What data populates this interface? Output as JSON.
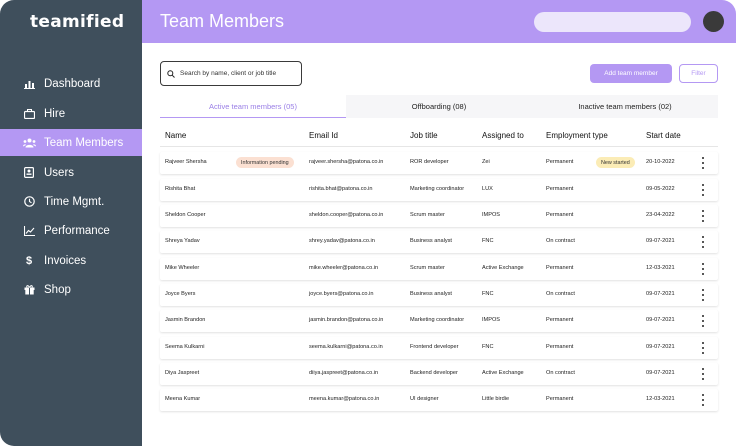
{
  "brand": {
    "logo": "teamified"
  },
  "nav": {
    "items": [
      {
        "label": "Dashboard",
        "icon": "bar-chart-icon",
        "active": false
      },
      {
        "label": "Hire",
        "icon": "briefcase-icon",
        "active": false
      },
      {
        "label": "Team Members",
        "icon": "users-icon",
        "active": true
      },
      {
        "label": "Users",
        "icon": "id-card-icon",
        "active": false
      },
      {
        "label": "Time Mgmt.",
        "icon": "clock-icon",
        "active": false
      },
      {
        "label": "Performance",
        "icon": "trend-line-icon",
        "active": false
      },
      {
        "label": "Invoices",
        "icon": "dollar-icon",
        "active": false
      },
      {
        "label": "Shop",
        "icon": "gift-icon",
        "active": false
      }
    ]
  },
  "header": {
    "title": "Team Members"
  },
  "toolbar": {
    "search_placeholder": "Search by name, client or job title",
    "add_label": "Add team member",
    "filter_label": "Filter"
  },
  "tabs": [
    {
      "label": "Active team members (05)",
      "active": true
    },
    {
      "label": "Offboarding (08)",
      "active": false
    },
    {
      "label": "Inactive team members (02)",
      "active": false
    }
  ],
  "table": {
    "columns": [
      "Name",
      "Email Id",
      "Job title",
      "Assigned to",
      "Employment type",
      "Start date"
    ],
    "rows": [
      {
        "name": "Rajveer Shersha",
        "badge": "Information pending",
        "email": "rajveer.shersha@patona.co.in",
        "job": "ROR developer",
        "assigned": "Zei",
        "type": "Permanent",
        "type_badge": "New started",
        "start": "20-10-2022"
      },
      {
        "name": "Rishita Bhat",
        "badge": "",
        "email": "rishita.bhat@patona.co.in",
        "job": "Marketing coordinator",
        "assigned": "LUX",
        "type": "Permanent",
        "type_badge": "",
        "start": "09-05-2022"
      },
      {
        "name": "Sheldon Cooper",
        "badge": "",
        "email": "sheldon.cooper@patona.co.in",
        "job": "Scrum master",
        "assigned": "IMPOS",
        "type": "Permanent",
        "type_badge": "",
        "start": "23-04-2022"
      },
      {
        "name": "Shreya Yadav",
        "badge": "",
        "email": "shrey.yadav@patona.co.in",
        "job": "Business analyst",
        "assigned": "FNC",
        "type": "On contract",
        "type_badge": "",
        "start": "09-07-2021"
      },
      {
        "name": "Mike Wheeler",
        "badge": "",
        "email": "mike.wheeler@patona.co.in",
        "job": "Scrum master",
        "assigned": "Active Exchange",
        "type": "Permanent",
        "type_badge": "",
        "start": "12-03-2021"
      },
      {
        "name": "Joyce Byers",
        "badge": "",
        "email": "joyce.byers@patona.co.in",
        "job": "Business analyst",
        "assigned": "FNC",
        "type": "On contract",
        "type_badge": "",
        "start": "09-07-2021"
      },
      {
        "name": "Jasmin Brandon",
        "badge": "",
        "email": "jasmin.brandon@patona.co.in",
        "job": "Marketing coordinator",
        "assigned": "IMPOS",
        "type": "Permanent",
        "type_badge": "",
        "start": "09-07-2021"
      },
      {
        "name": "Seema Kulkarni",
        "badge": "",
        "email": "seema.kulkarni@patona.co.in",
        "job": "Frontend developer",
        "assigned": "FNC",
        "type": "Permanent",
        "type_badge": "",
        "start": "09-07-2021"
      },
      {
        "name": "Diya Jaspreet",
        "badge": "",
        "email": "diiya.jaspreet@patona.co.in",
        "job": "Backend developer",
        "assigned": "Active Exchange",
        "type": "On contract",
        "type_badge": "",
        "start": "09-07-2021"
      },
      {
        "name": "Meena Kumar",
        "badge": "",
        "email": "meena.kumar@patona.co.in",
        "job": "UI designer",
        "assigned": "Little birdie",
        "type": "Permanent",
        "type_badge": "",
        "start": "12-03-2021"
      }
    ]
  },
  "colors": {
    "sidebar": "#3f4f5c",
    "accent": "#b498f3",
    "pending_badge": "#fbe0d2",
    "new_badge": "#fbecb6"
  }
}
